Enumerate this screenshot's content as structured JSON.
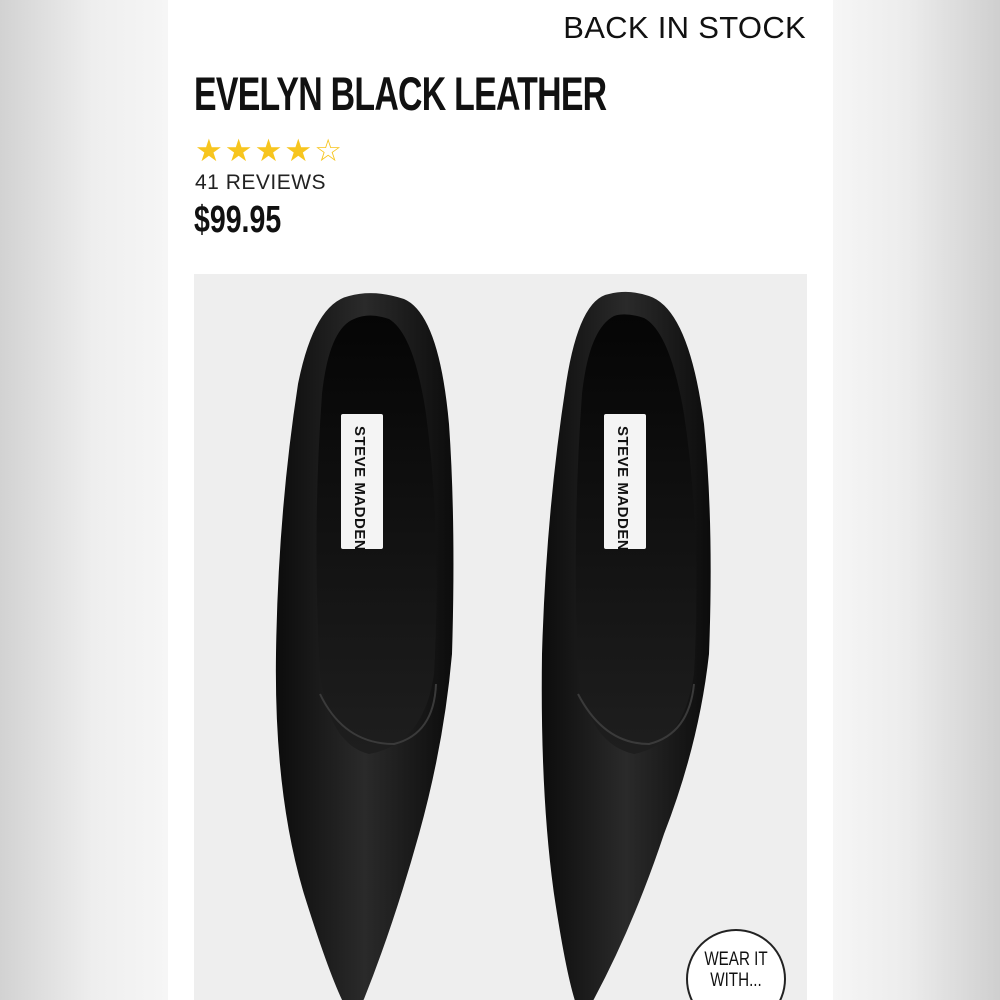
{
  "status_text": "BACK IN STOCK",
  "product": {
    "name": "EVELYN BLACK LEATHER",
    "rating": 4,
    "rating_max": 5,
    "reviews": "41 REVIEWS",
    "price": "$99.95",
    "brand_label": "STEVE MADDEN"
  },
  "wear_it": {
    "label": "WEAR IT WITH..."
  },
  "icons": {
    "star": "star-filled-icon",
    "star_empty": "star-outline-icon"
  },
  "colors": {
    "star": "#f7c51e",
    "photo_bg": "#eeeeee",
    "shoe": "#151515"
  }
}
